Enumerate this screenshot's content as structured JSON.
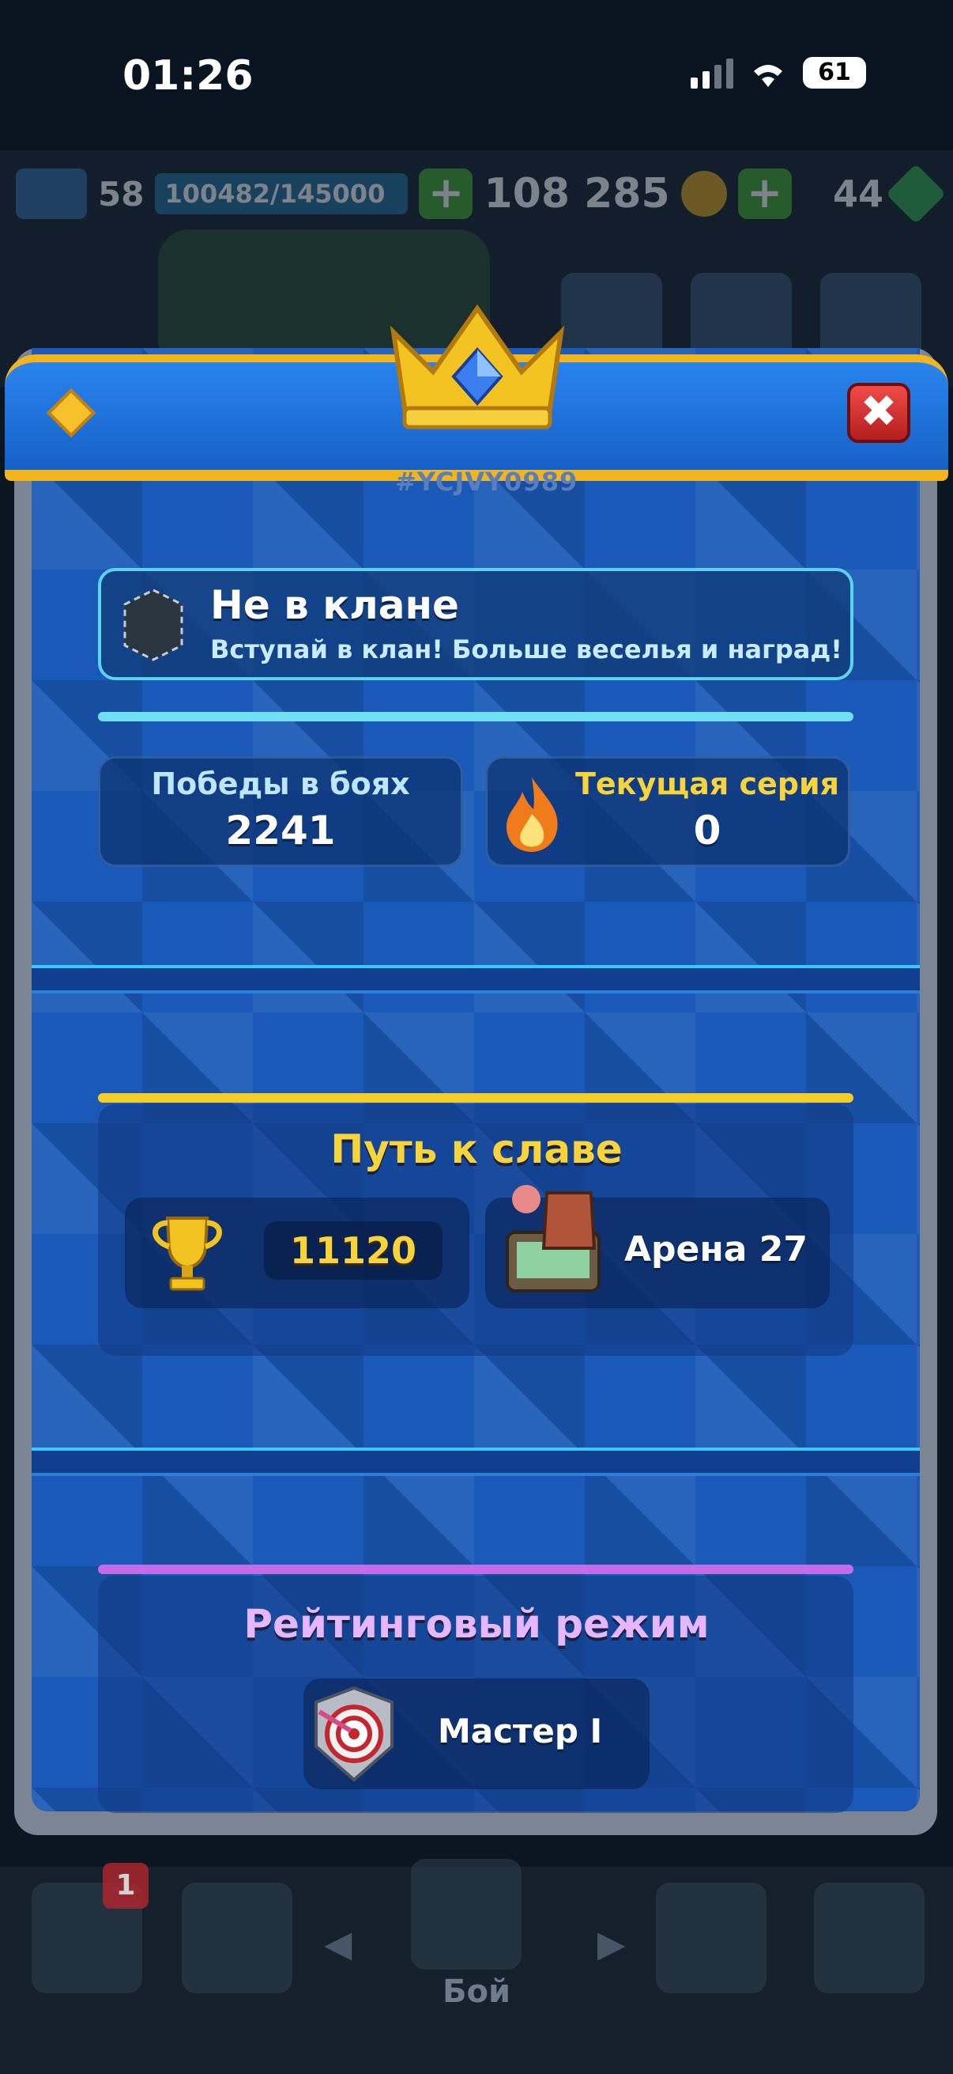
{
  "status_bar": {
    "time": "01:26",
    "battery": "61"
  },
  "background_hud": {
    "level": "58",
    "xp": "100482/145000",
    "gold": "108 285",
    "gems": "44",
    "plus_symbol": "+",
    "battle_label": "Бой",
    "nav_badge": "1"
  },
  "modal": {
    "player_tag": "#YCJVY0989",
    "close_symbol": "✖",
    "clan": {
      "title": "Не в клане",
      "subtitle": "Вступай в клан! Больше веселья и наград!"
    },
    "stats": {
      "wins_label": "Победы в боях",
      "wins_value": "2241",
      "streak_label": "Текущая серия",
      "streak_value": "0"
    },
    "path_of_glory": {
      "title": "Путь к славе",
      "trophies": "11120",
      "arena": "Арена 27"
    },
    "ranked": {
      "title": "Рейтинговый режим",
      "rank": "Мастер I"
    }
  },
  "colors": {
    "stat_label_wins": "#bfe6ff",
    "stat_label_streak": "#f7d43b",
    "path_title": "#f7d43b",
    "ranked_title": "#e6b7ff",
    "trophy_value": "#f7d43b"
  }
}
